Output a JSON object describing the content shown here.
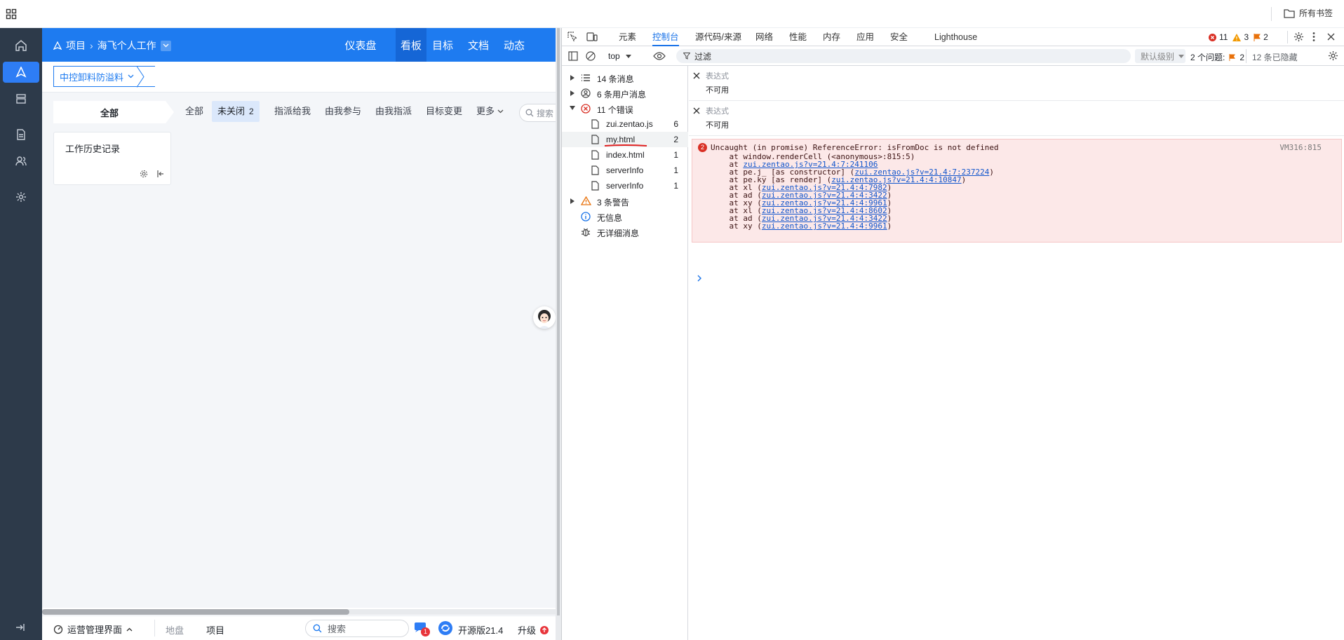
{
  "browser": {
    "bookmarks_label": "所有书签"
  },
  "app": {
    "breadcrumb": {
      "root": "项目",
      "sep": "›",
      "current": "海飞个人工作"
    },
    "top_tabs": [
      "仪表盘",
      "看板",
      "目标",
      "文档",
      "动态"
    ],
    "active_top_tab": "看板",
    "sub_selector": "中控卸料防溢料",
    "sidebar_column_title": "全部",
    "filter_tabs": [
      {
        "label": "全部"
      },
      {
        "label": "未关闭",
        "badge": "2"
      },
      {
        "label": "指派给我"
      },
      {
        "label": "由我参与"
      },
      {
        "label": "由我指派"
      },
      {
        "label": "目标变更"
      },
      {
        "label": "更多"
      }
    ],
    "search_placeholder": "搜索",
    "card_title": "工作历史记录",
    "bottom": {
      "mode_label": "运营管理界面",
      "crumb1": "地盘",
      "crumb2": "项目",
      "search_placeholder": "搜索",
      "ai_badge": "1",
      "edition": "开源版21.4",
      "upgrade": "升级"
    },
    "colors": {
      "primary": "#1e7bf0",
      "sidebar": "#2d3a4a"
    }
  },
  "devtools": {
    "tabs": [
      "元素",
      "控制台",
      "源代码/来源",
      "网络",
      "性能",
      "内存",
      "应用",
      "安全",
      "Lighthouse"
    ],
    "active_tab": "控制台",
    "status": {
      "errors": "11",
      "warnings": "3",
      "issues": "2"
    },
    "toolbar": {
      "context": "top",
      "filter_placeholder": "过滤",
      "level": "默认级别",
      "issues_label": "2 个问题:",
      "issues_count": "2",
      "hidden": "12 条已隐藏"
    },
    "side": [
      {
        "label": "14 条消息",
        "count": ""
      },
      {
        "label": "6 条用户消息",
        "count": ""
      },
      {
        "label": "11 个错误",
        "count": ""
      },
      {
        "label": "zui.zentao.js",
        "count": "6"
      },
      {
        "label": "my.html",
        "count": "2"
      },
      {
        "label": "index.html",
        "count": "1"
      },
      {
        "label": "serverInfo",
        "count": "1"
      },
      {
        "label": "serverInfo",
        "count": "1"
      },
      {
        "label": "3 条警告",
        "count": ""
      },
      {
        "label": "无信息",
        "count": ""
      },
      {
        "label": "无详细消息",
        "count": ""
      }
    ],
    "expressions": [
      {
        "label": "表达式",
        "value": "不可用"
      },
      {
        "label": "表达式",
        "value": "不可用"
      }
    ],
    "error": {
      "count": "2",
      "message": "Uncaught (in promise) ReferenceError: isFromDoc is not defined",
      "source": "VM316:815",
      "stack": [
        {
          "pre": "    at window.renderCell (<anonymous>:815:5)",
          "link": "",
          "post": ""
        },
        {
          "pre": "    at ",
          "link": "zui.zentao.js?v=21.4:7:241106",
          "post": ""
        },
        {
          "pre": "    at pe.j_ [as constructor] (",
          "link": "zui.zentao.js?v=21.4:7:237224",
          "post": ")"
        },
        {
          "pre": "    at pe.ky [as render] (",
          "link": "zui.zentao.js?v=21.4:4:10847",
          "post": ")"
        },
        {
          "pre": "    at xl (",
          "link": "zui.zentao.js?v=21.4:4:7982",
          "post": ")"
        },
        {
          "pre": "    at ad (",
          "link": "zui.zentao.js?v=21.4:4:3422",
          "post": ")"
        },
        {
          "pre": "    at xy (",
          "link": "zui.zentao.js?v=21.4:4:9961",
          "post": ")"
        },
        {
          "pre": "    at xl (",
          "link": "zui.zentao.js?v=21.4:4:8602",
          "post": ")"
        },
        {
          "pre": "    at ad (",
          "link": "zui.zentao.js?v=21.4:4:3422",
          "post": ")"
        },
        {
          "pre": "    at xy (",
          "link": "zui.zentao.js?v=21.4:4:9961",
          "post": ")"
        }
      ]
    }
  }
}
